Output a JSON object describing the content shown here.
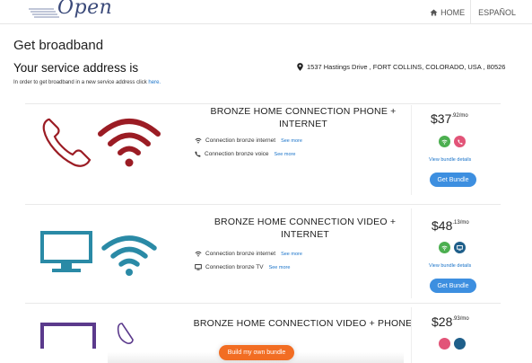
{
  "header": {
    "logo_text": "Open",
    "nav_home": "HOME",
    "nav_lang": "ESPAÑOL"
  },
  "page": {
    "title": "Get broadband",
    "service_title": "Your service address is",
    "note_prefix": "In order to get broadband in a new service address click",
    "note_link": "here.",
    "address": "1537 Hastings Drive , FORT COLLINS, COLORADO, USA , 80526"
  },
  "bundles": [
    {
      "title_line1": "BRONZE HOME CONNECTION PHONE +",
      "title_line2": "INTERNET",
      "features": [
        {
          "icon": "wifi-icon",
          "text": "Connection bronze internet",
          "link": "See more"
        },
        {
          "icon": "phone-icon",
          "text": "Connection bronze voice",
          "link": "See more"
        }
      ],
      "price_currency": "$",
      "price_whole": "37",
      "price_cents": ".92/mo",
      "details_link": "View bundle details",
      "button": "Get Bundle",
      "colors": {
        "icon_main": "#9b1c24",
        "badge1": "#4caf50",
        "badge2": "#e25478"
      }
    },
    {
      "title_line1": "BRONZE HOME CONNECTION VIDEO +",
      "title_line2": "INTERNET",
      "features": [
        {
          "icon": "wifi-icon",
          "text": "Connection bronze internet",
          "link": "See more"
        },
        {
          "icon": "tv-icon",
          "text": "Connection bronze TV",
          "link": "See more"
        }
      ],
      "price_currency": "$",
      "price_whole": "48",
      "price_cents": ".13/mo",
      "details_link": "View bundle details",
      "button": "Get Bundle",
      "colors": {
        "icon_main": "#2a8aa6",
        "badge1": "#4caf50",
        "badge2": "#1f5f8a"
      }
    },
    {
      "title_line1": "BRONZE HOME CONNECTION VIDEO + PHONE",
      "title_line2": "",
      "price_currency": "$",
      "price_whole": "28",
      "price_cents": ".93/mo",
      "colors": {
        "icon_main": "#5b3a8c",
        "badge1": "#e25478",
        "badge2": "#1f5f8a"
      }
    }
  ],
  "footer": {
    "build_button": "Build my own bundle",
    "colors": {
      "accent": "#f26d23",
      "primary": "#3d8fe0",
      "link": "#1a73c9"
    }
  }
}
